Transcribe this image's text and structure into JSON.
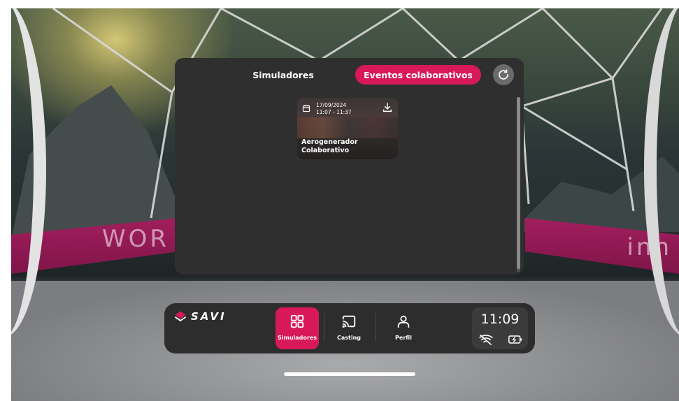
{
  "tabs": {
    "simuladores": "Simuladores",
    "eventos": "Eventos colaborativos"
  },
  "event_card": {
    "date": "17/09/2024",
    "time": "11:07 - 11:37",
    "title_line1": "Aerogenerador",
    "title_line2": "Colaborativo"
  },
  "environment": {
    "banner_left": "WOR",
    "banner_right": "inn"
  },
  "dock": {
    "brand": "SAVI",
    "nav": [
      {
        "label": "Simuladores",
        "icon": "grid-icon",
        "active": true
      },
      {
        "label": "Casting",
        "icon": "cast-icon",
        "active": false
      },
      {
        "label": "Perfil",
        "icon": "user-icon",
        "active": false
      }
    ],
    "clock": "11:09",
    "wifi_status": "wifi-off-icon",
    "battery_status": "battery-charging-icon"
  },
  "colors": {
    "accent": "#d7195a",
    "panel": "#2f2f2f",
    "dock": "#2d2d2d"
  }
}
